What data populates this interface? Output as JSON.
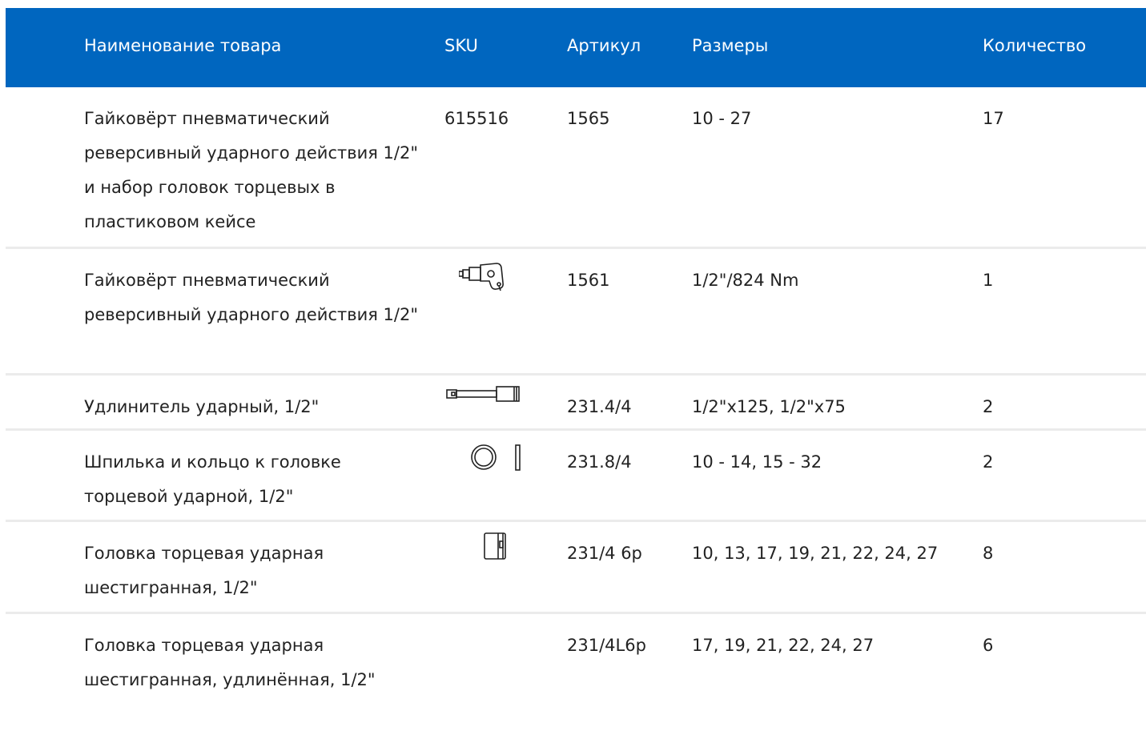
{
  "header": {
    "name": "Наименование товара",
    "sku": "SKU",
    "article": "Артикул",
    "sizes": "Размеры",
    "quantity": "Количество"
  },
  "colors": {
    "header_bg": "#0066bf",
    "header_text": "#ffffff",
    "divider": "#ebebeb",
    "text": "#222222"
  },
  "rows": [
    {
      "name": "Гайковёрт пневматический реверсивный ударного действия 1/2\" и набор головок торцевых в пластиковом кейсе",
      "sku": "615516",
      "sku_icon": "",
      "article": "1565",
      "sizes": "10 - 27",
      "quantity": "17"
    },
    {
      "name": "Гайковёрт пневматический реверсивный ударного действия 1/2\"",
      "sku": "",
      "sku_icon": "impact-wrench-icon",
      "article": "1561",
      "sizes": "1/2\"/824 Nm",
      "quantity": "1"
    },
    {
      "name": "Удлинитель ударный, 1/2\"",
      "sku": "",
      "sku_icon": "extension-bar-icon",
      "article": "231.4/4",
      "sizes": "1/2\"x125, 1/2\"x75",
      "quantity": "2"
    },
    {
      "name": "Шпилька и кольцо к головке торцевой ударной, 1/2\"",
      "sku": "",
      "sku_icon": "pin-ring-icon",
      "article": "231.8/4",
      "sizes": "10 - 14, 15 - 32",
      "quantity": "2"
    },
    {
      "name": "Головка торцевая ударная шестигранная, 1/2\"",
      "sku": "",
      "sku_icon": "impact-socket-icon",
      "article": "231/4 6р",
      "sizes": "10, 13, 17, 19, 21, 22, 24, 27",
      "quantity": "8"
    },
    {
      "name": "Головка торцевая ударная шестигранная, удлинённая, 1/2\"",
      "sku": "",
      "sku_icon": "",
      "article": "231/4L6р",
      "sizes": "17, 19, 21, 22, 24, 27",
      "quantity": "6"
    }
  ]
}
